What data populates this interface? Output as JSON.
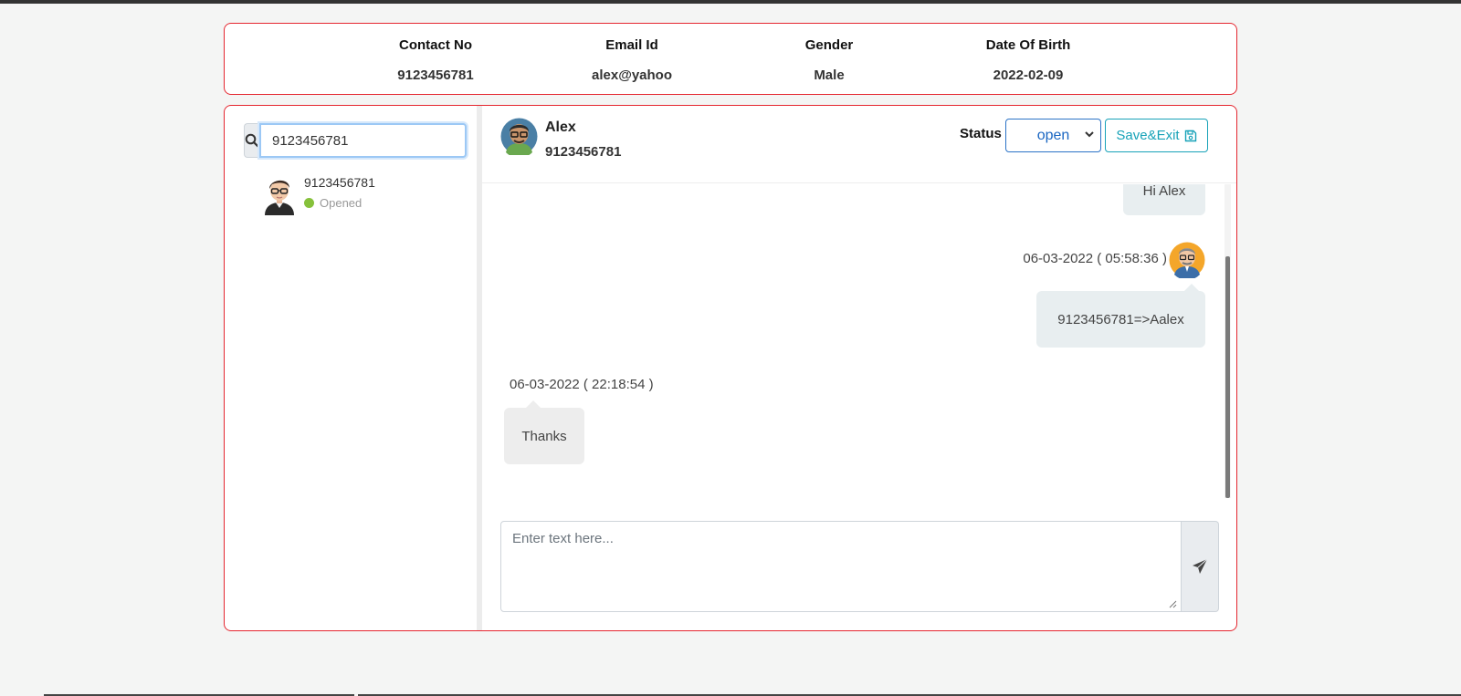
{
  "info": {
    "contact_label": "Contact No",
    "contact_value": "9123456781",
    "email_label": "Email Id",
    "email_value": "alex@yahoo",
    "gender_label": "Gender",
    "gender_value": "Male",
    "dob_label": "Date Of Birth",
    "dob_value": "2022-02-09"
  },
  "search": {
    "value": "9123456781"
  },
  "contacts": [
    {
      "name": "9123456781",
      "status": "Opened"
    }
  ],
  "chat": {
    "name": "Alex",
    "phone": "9123456781",
    "status_label": "Status",
    "status_value": "open",
    "save_label": "Save&Exit"
  },
  "messages": [
    {
      "direction": "out",
      "text": "Hi Alex"
    },
    {
      "direction": "out",
      "timestamp": "06-03-2022 ( 05:58:36 )",
      "text": "9123456781=>Aalex"
    },
    {
      "direction": "in",
      "timestamp": "06-03-2022 ( 22:18:54 )",
      "text": "Thanks"
    }
  ],
  "composer": {
    "placeholder": "Enter text here..."
  },
  "colors": {
    "panel_border": "#e5262f",
    "status_dot": "#86c13b",
    "save_accent": "#17a2b8",
    "select_accent": "#2b73c7"
  }
}
